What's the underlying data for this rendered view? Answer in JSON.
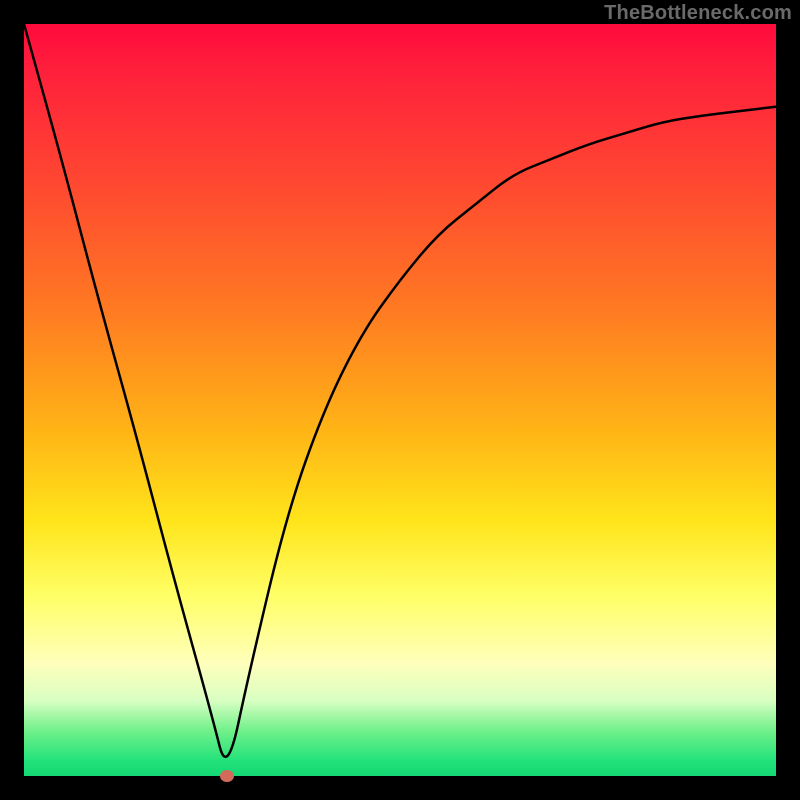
{
  "watermark": "TheBottleneck.com",
  "chart_data": {
    "type": "line",
    "title": "",
    "xlabel": "",
    "ylabel": "",
    "xlim": [
      0,
      100
    ],
    "ylim": [
      0,
      100
    ],
    "x": [
      0,
      5,
      10,
      15,
      20,
      25,
      27,
      30,
      35,
      40,
      45,
      50,
      55,
      60,
      65,
      70,
      75,
      80,
      85,
      90,
      95,
      100
    ],
    "values": [
      100,
      82,
      63,
      45,
      26,
      8,
      0,
      14,
      35,
      49,
      59,
      66,
      72,
      76,
      80,
      82,
      84,
      85.5,
      87,
      87.8,
      88.4,
      89
    ],
    "marker": {
      "x": 27,
      "y": 0
    },
    "gradient_stops": [
      {
        "pos": 0,
        "color": "#ff0a3c"
      },
      {
        "pos": 22,
        "color": "#ff4a30"
      },
      {
        "pos": 54,
        "color": "#ffe41a"
      },
      {
        "pos": 85,
        "color": "#ffffbb"
      },
      {
        "pos": 100,
        "color": "#14d873"
      }
    ]
  }
}
